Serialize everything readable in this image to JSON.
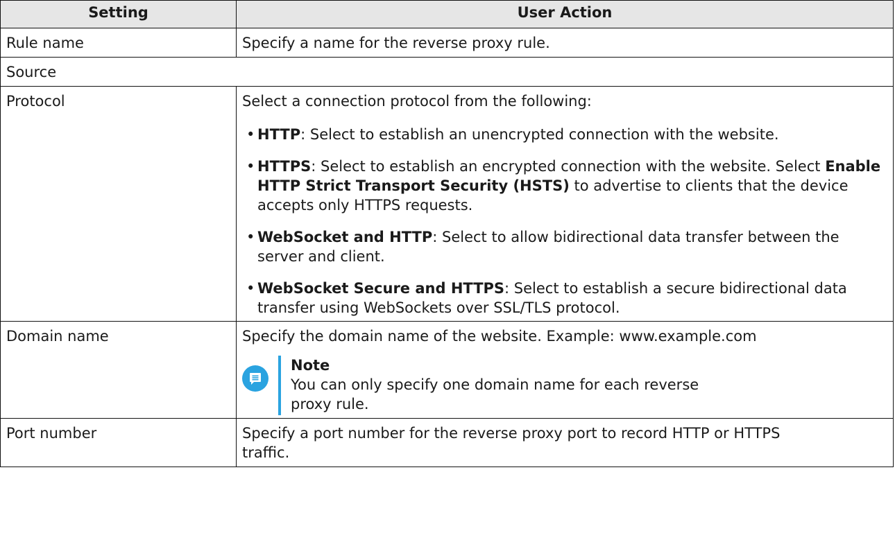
{
  "header": {
    "setting": "Setting",
    "action": "User Action"
  },
  "rows": {
    "rule_name": {
      "setting": "Rule name",
      "action": "Specify a name for the reverse proxy rule."
    },
    "source": {
      "section": "Source"
    },
    "protocol": {
      "setting": "Protocol",
      "intro": "Select a connection protocol from the following:",
      "items": [
        {
          "term": "HTTP",
          "text": ": Select to establish an unencrypted connection with the website."
        },
        {
          "term": "HTTPS",
          "text": ": Select to establish an encrypted connection with the website. Select ",
          "term2": "Enable HTTP Strict Transport Security (HSTS)",
          "text2": " to advertise to clients that the device accepts only HTTPS requests."
        },
        {
          "term": "WebSocket and HTTP",
          "text": ": Select to allow bidirectional data transfer between the server and client."
        },
        {
          "term": "WebSocket Secure and HTTPS",
          "text": ": Select to establish a secure bidirectional data transfer using WebSockets over SSL/TLS protocol."
        }
      ]
    },
    "domain": {
      "setting": "Domain name",
      "action": "Specify the domain name of the website. Example: www.example.com",
      "note_title": "Note",
      "note_line1": "You can only specify one domain name for each reverse",
      "note_line2": "proxy rule.",
      "note_icon": "note-icon"
    },
    "port": {
      "setting": "Port number",
      "action_line1": "Specify a port number for the reverse proxy port to record HTTP or HTTPS",
      "action_line2": "traffic."
    }
  }
}
